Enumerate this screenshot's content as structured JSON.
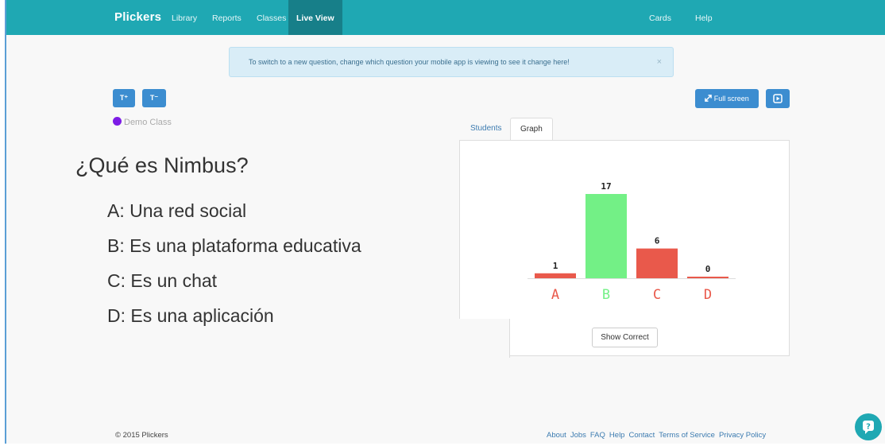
{
  "navbar": {
    "brand": "Plickers",
    "items": [
      "Library",
      "Reports",
      "Classes",
      "Live View"
    ],
    "right_items": [
      "Cards",
      "Help"
    ]
  },
  "alert": {
    "message": "To switch to a new question, change which question your mobile app is viewing to see it change here!",
    "close": "×"
  },
  "toolbar": {
    "font_up": "T⁺",
    "font_down": "T⁻",
    "fullscreen_label": "Full screen",
    "fullscreen_icon": "expand-icon",
    "present_icon": "play-icon"
  },
  "class": {
    "name": "Demo Class",
    "color": "#7d1ce6"
  },
  "question": {
    "text": "¿Qué es Nimbus?",
    "answers": [
      {
        "letter": "A:",
        "text": "Una red social"
      },
      {
        "letter": "B:",
        "text": "Es una plataforma educativa"
      },
      {
        "letter": "C:",
        "text": "Es un chat"
      },
      {
        "letter": "D:",
        "text": "Es una aplicación"
      }
    ]
  },
  "tabs": {
    "students": "Students",
    "graph": "Graph"
  },
  "chart_data": {
    "type": "bar",
    "categories": [
      "A",
      "B",
      "C",
      "D"
    ],
    "values": [
      1,
      17,
      6,
      0
    ],
    "colors": [
      "#e9594b",
      "#73f086",
      "#e9594b",
      "#e9594b"
    ],
    "ylim": [
      0,
      17
    ]
  },
  "show_correct": "Show Correct",
  "footer": {
    "copyright": "© 2015 Plickers",
    "links": [
      "About",
      "Jobs",
      "FAQ",
      "Help",
      "Contact",
      "Terms of Service",
      "Privacy Policy"
    ]
  },
  "help_bubble_icon": "chat-help-icon"
}
